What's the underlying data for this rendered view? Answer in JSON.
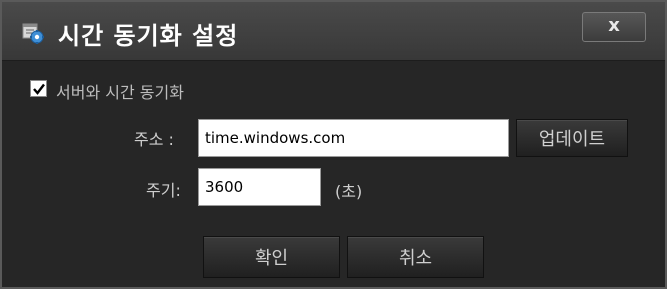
{
  "dialog": {
    "title": "시간 동기화 설정",
    "close_label": "x"
  },
  "sync": {
    "checkbox_label": "서버와 시간 동기화",
    "checked": true
  },
  "address": {
    "label": "주소 :",
    "value": "time.windows.com",
    "update_button": "업데이트"
  },
  "period": {
    "label": "주기:",
    "value": "3600",
    "unit": "(초)"
  },
  "actions": {
    "ok": "확인",
    "cancel": "취소"
  },
  "icons": {
    "title": "clock-gear-icon",
    "checkbox": "checkmark-icon"
  }
}
